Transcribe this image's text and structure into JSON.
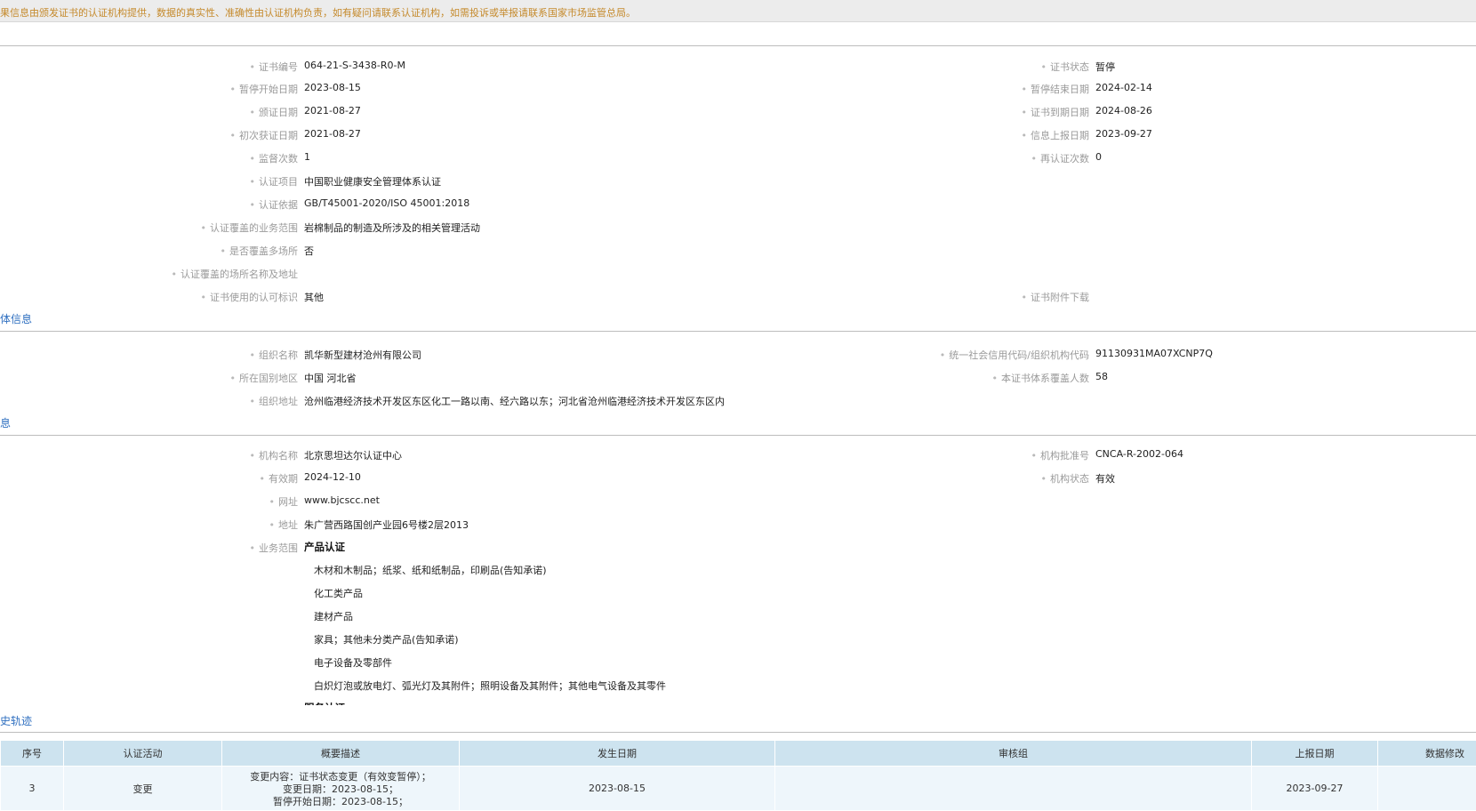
{
  "notice": "果信息由颁发证书的认证机构提供，数据的真实性、准确性由认证机构负责，如有疑问请联系认证机构，如需投诉或举报请联系国家市场监管总局。",
  "cert": {
    "left": [
      {
        "label": "证书编号",
        "value": "064-21-S-3438-R0-M"
      },
      {
        "label": "暂停开始日期",
        "value": "2023-08-15"
      },
      {
        "label": "颁证日期",
        "value": "2021-08-27"
      },
      {
        "label": "初次获证日期",
        "value": "2021-08-27"
      },
      {
        "label": "监督次数",
        "value": "1"
      },
      {
        "label": "认证项目",
        "value": "中国职业健康安全管理体系认证"
      },
      {
        "label": "认证依据",
        "value": "GB/T45001-2020/ISO 45001:2018"
      },
      {
        "label": "认证覆盖的业务范围",
        "value": "岩棉制品的制造及所涉及的相关管理活动"
      },
      {
        "label": "是否覆盖多场所",
        "value": "否"
      },
      {
        "label": "认证覆盖的场所名称及地址",
        "value": ""
      },
      {
        "label": "证书使用的认可标识",
        "value": "其他"
      }
    ],
    "right": [
      {
        "label": "证书状态",
        "value": "暂停"
      },
      {
        "label": "暂停结束日期",
        "value": "2024-02-14"
      },
      {
        "label": "证书到期日期",
        "value": "2024-08-26"
      },
      {
        "label": "信息上报日期",
        "value": "2023-09-27"
      },
      {
        "label": "再认证次数",
        "value": "0"
      },
      {
        "label": "证书附件下载",
        "value": ""
      }
    ]
  },
  "org_section_title": "体信息",
  "org": {
    "left": [
      {
        "label": "组织名称",
        "value": "凯华新型建材沧州有限公司"
      },
      {
        "label": "所在国别地区",
        "value": "中国 河北省"
      },
      {
        "label": "组织地址",
        "value": "沧州临港经济技术开发区东区化工一路以南、经六路以东；河北省沧州临港经济技术开发区东区内"
      }
    ],
    "right": [
      {
        "label": "统一社会信用代码/组织机构代码",
        "value": "91130931MA07XCNP7Q"
      },
      {
        "label": "本证书体系覆盖人数",
        "value": "58"
      }
    ]
  },
  "agency_section_title": "息",
  "agency": {
    "left": [
      {
        "label": "机构名称",
        "value": "北京思坦达尔认证中心"
      },
      {
        "label": "有效期",
        "value": "2024-12-10"
      },
      {
        "label": "网址",
        "value": "www.bjcscc.net"
      },
      {
        "label": "地址",
        "value": "朱广营西路国创产业园6号楼2层2013"
      },
      {
        "label": "业务范围",
        "value": "产品认证"
      }
    ],
    "right": [
      {
        "label": "机构批准号",
        "value": "CNCA-R-2002-064"
      },
      {
        "label": "机构状态",
        "value": "有效"
      }
    ],
    "scope_items": [
      "木材和木制品；纸浆、纸和纸制品，印刷品(告知承诺)",
      "化工类产品",
      "建材产品",
      "家具；其他未分类产品(告知承诺)",
      "电子设备及零部件",
      "白炽灯泡或放电灯、弧光灯及其附件；照明设备及其附件；其他电气设备及其零件"
    ],
    "scope_cut": "服务认证"
  },
  "history_section_title": "史轨迹",
  "history": {
    "headers": [
      "序号",
      "认证活动",
      "概要描述",
      "发生日期",
      "审核组",
      "上报日期",
      "数据修改"
    ],
    "row": {
      "no": "3",
      "activity": "变更",
      "desc1": "变更内容：证书状态变更（有效变暂停）；",
      "desc2": "变更日期：2023-08-15；",
      "desc3": "暂停开始日期：2023-08-15；",
      "date": "2023-08-15",
      "team": "",
      "report": "2023-09-27",
      "modify": ""
    }
  }
}
